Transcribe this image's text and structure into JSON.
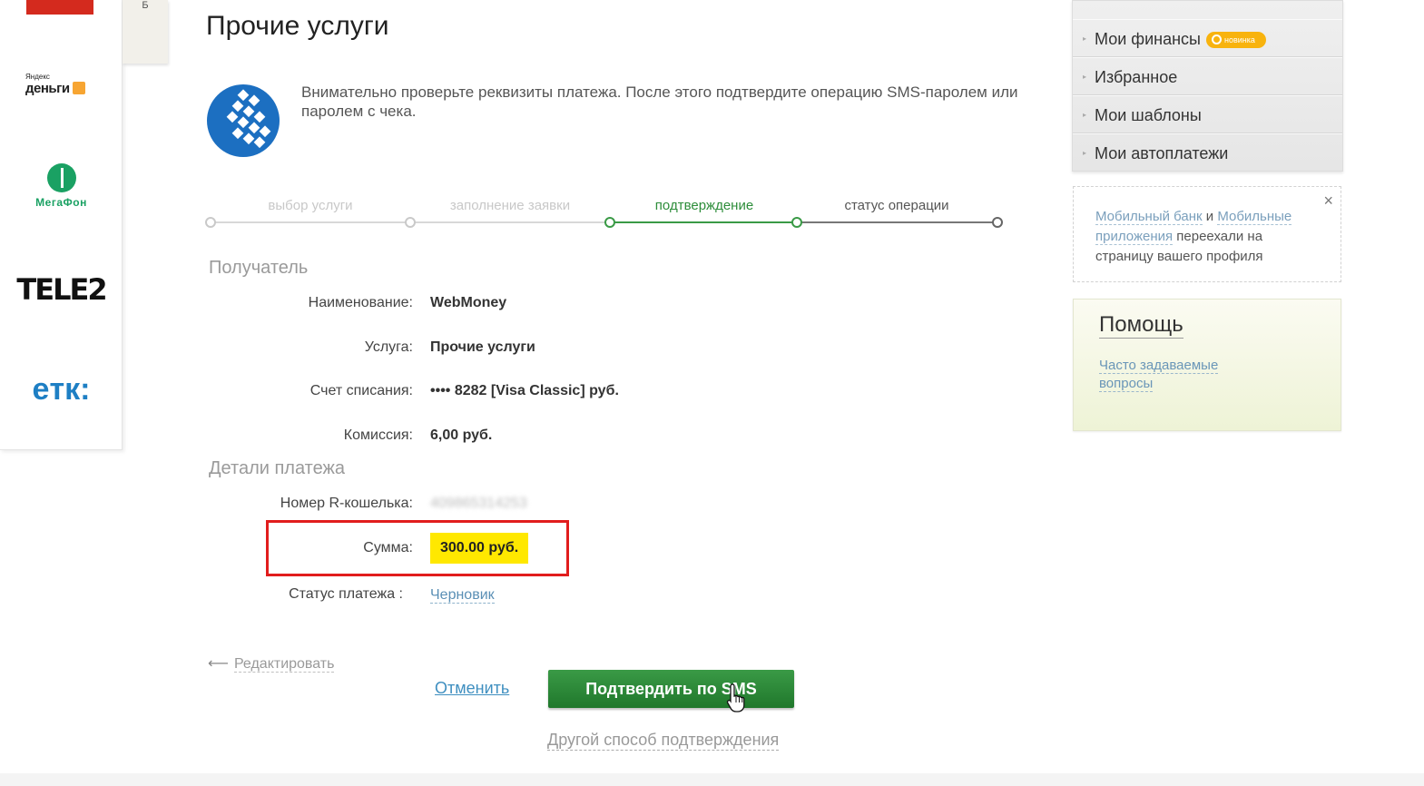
{
  "page": {
    "title": "Прочие услуги"
  },
  "providers": [
    {
      "name": "Яндекс Деньги",
      "small": "Яндекс",
      "big": "деньги"
    },
    {
      "name": "МегаФон",
      "text": "МегаФон"
    },
    {
      "name": "TELE2",
      "text": "TELE2"
    },
    {
      "name": "ЕТК",
      "text": "eтк:"
    }
  ],
  "side_tab": {
    "label": "Б"
  },
  "notice": "Внимательно проверьте реквизиты платежа. После этого подтвердите операцию SMS-паролем или паролем с чека.",
  "steps": [
    {
      "label": "выбор услуги",
      "state": "done"
    },
    {
      "label": "заполнение заявки",
      "state": "done"
    },
    {
      "label": "подтверждение",
      "state": "active"
    },
    {
      "label": "статус операции",
      "state": "next"
    }
  ],
  "recipient": {
    "heading": "Получатель",
    "name_label": "Наименование:",
    "name_value": "WebMoney",
    "service_label": "Услуга:",
    "service_value": "Прочие услуги",
    "account_label": "Счет списания:",
    "account_value": "•••• 8282  [Visa Classic]  руб.",
    "fee_label": "Комиссия:",
    "fee_value": "6,00 руб."
  },
  "details": {
    "heading": "Детали платежа",
    "wallet_label": "Номер R-кошелька:",
    "wallet_value": "409865314253",
    "amount_label": "Сумма:",
    "amount_value": "300.00 руб.",
    "status_label": "Статус платежа :",
    "status_value": "Черновик"
  },
  "actions": {
    "edit": "Редактировать",
    "cancel": "Отменить",
    "confirm": "Подтвердить по SMS",
    "other": "Другой способ подтверждения"
  },
  "menu": {
    "items": [
      {
        "label": "Мои финансы",
        "badge": "новинка"
      },
      {
        "label": "Избранное"
      },
      {
        "label": "Мои шаблоны"
      },
      {
        "label": "Мои автоплатежи"
      }
    ]
  },
  "mobile_notice": {
    "link1": "Мобильный банк",
    "and": " и ",
    "link2": "Мобильные приложения",
    "rest": " переехали на страницу вашего профиля",
    "close": "×"
  },
  "help": {
    "title": "Помощь",
    "faq": "Часто задаваемые вопросы"
  },
  "colors": {
    "brand_green": "#2d8d3a",
    "amount_highlight": "#ffe800",
    "highlight_box": "#e11d1d",
    "badge": "#f8b30e"
  }
}
